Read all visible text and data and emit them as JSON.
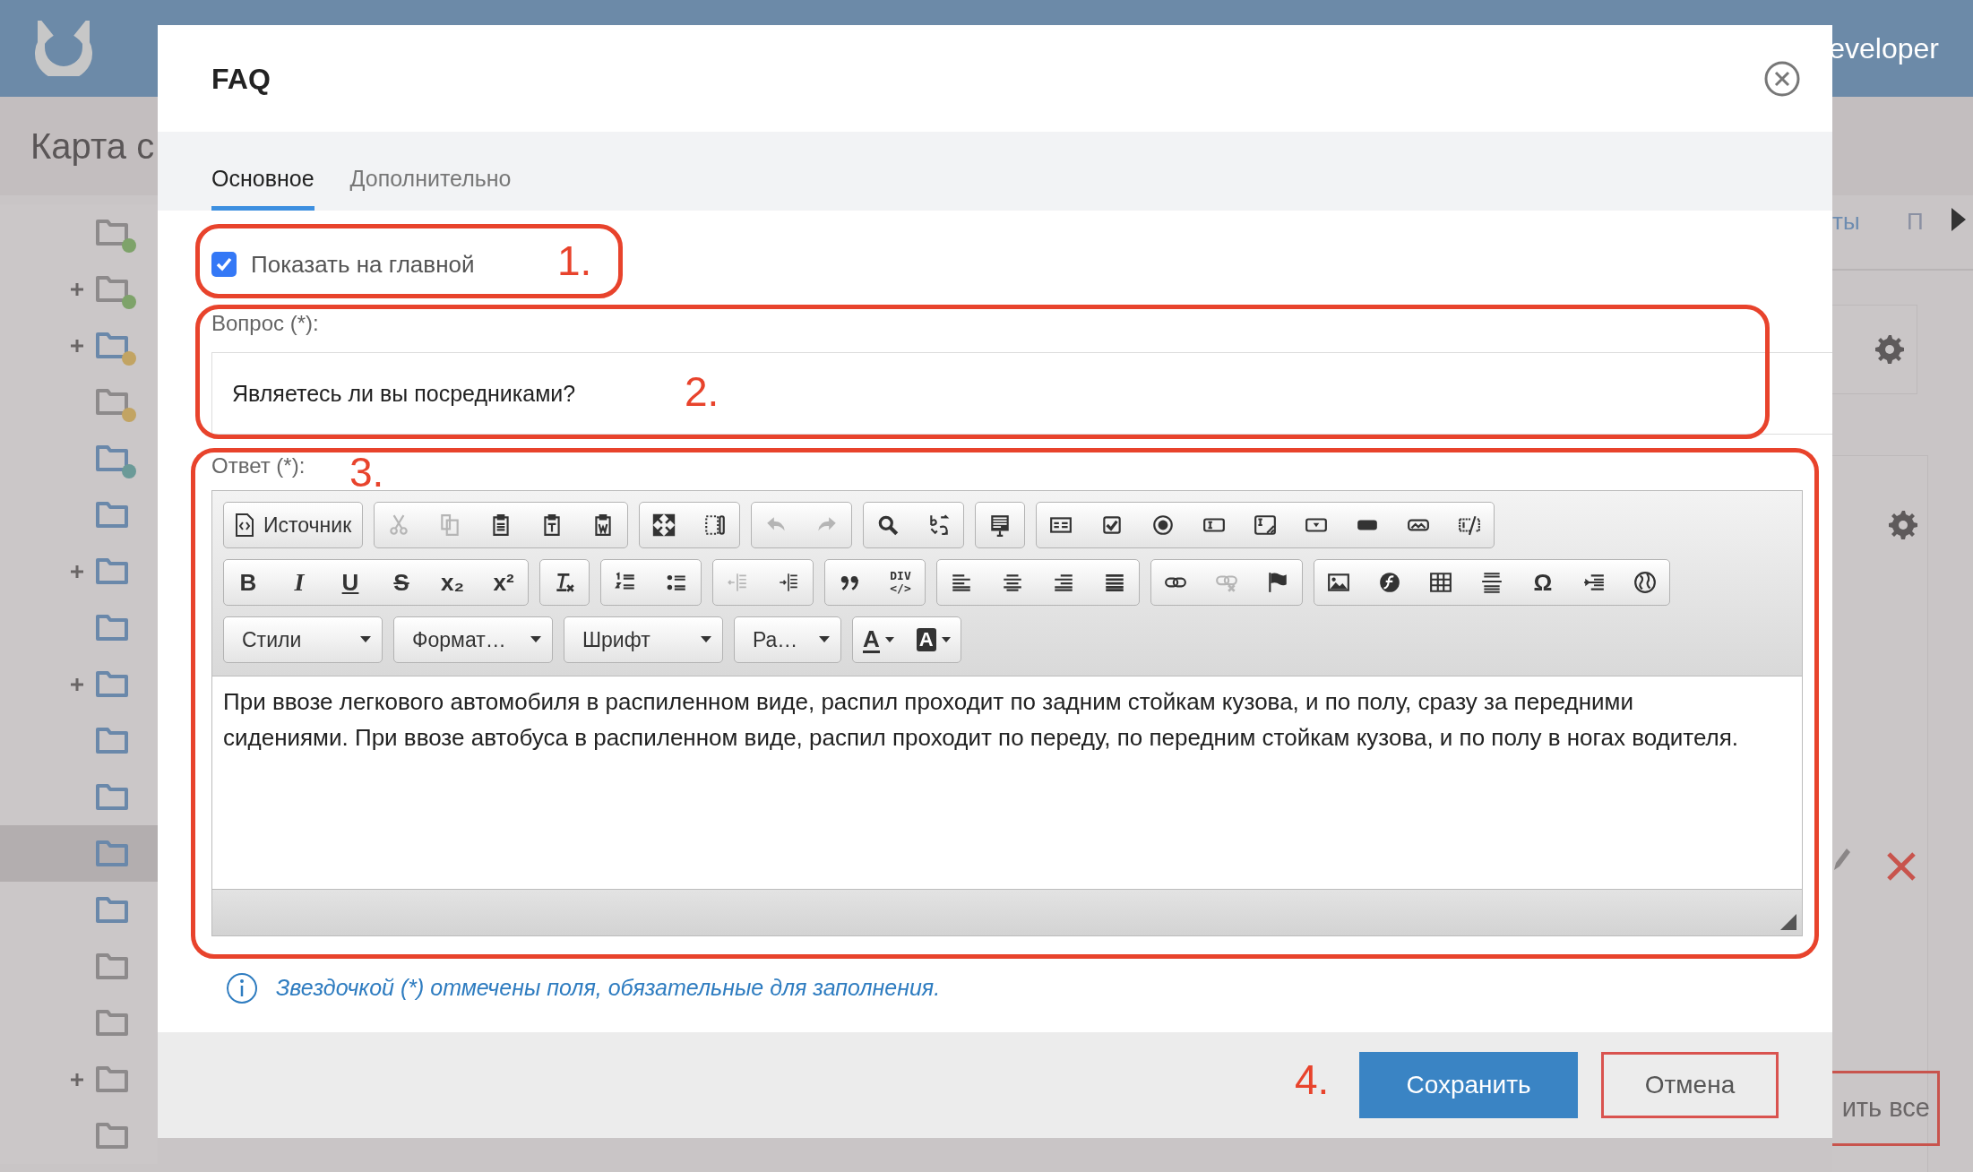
{
  "app_bar": {
    "user": "eveloper"
  },
  "page_title": "Карта с",
  "tree": [
    {
      "expandable": false,
      "active": false,
      "color": "#7ea36a",
      "selected": false
    },
    {
      "expandable": true,
      "active": false,
      "color": "#7ea36a",
      "selected": false
    },
    {
      "expandable": true,
      "active": true,
      "color": "#c2a463",
      "selected": false
    },
    {
      "expandable": false,
      "active": false,
      "color": "#c2a463",
      "selected": false
    },
    {
      "expandable": false,
      "active": true,
      "color": "#6b9a98",
      "selected": false
    },
    {
      "expandable": false,
      "active": true,
      "selected": false
    },
    {
      "expandable": true,
      "active": true,
      "selected": false
    },
    {
      "expandable": false,
      "active": true,
      "selected": false
    },
    {
      "expandable": true,
      "active": true,
      "selected": false
    },
    {
      "expandable": false,
      "active": true,
      "selected": false
    },
    {
      "expandable": false,
      "active": true,
      "selected": false
    },
    {
      "expandable": false,
      "active": true,
      "selected": true
    },
    {
      "expandable": false,
      "active": true,
      "selected": false
    },
    {
      "expandable": false,
      "active": false,
      "selected": false
    },
    {
      "expandable": false,
      "active": false,
      "selected": false
    },
    {
      "expandable": true,
      "active": false,
      "selected": false
    },
    {
      "expandable": false,
      "active": false,
      "selected": false
    }
  ],
  "right_tabs": [
    {
      "label": "ты",
      "disabled": false
    },
    {
      "label": "П",
      "disabled": true
    }
  ],
  "save_all_button": "ить все",
  "dialog": {
    "title": "FAQ",
    "tabs": [
      {
        "label": "Основное",
        "selected": true
      },
      {
        "label": "Дополнительно",
        "selected": false
      }
    ],
    "show_on_main": {
      "label": "Показать на главной",
      "checked": true
    },
    "question": {
      "label": "Вопрос (*):",
      "value": "Являетесь ли вы посредниками?"
    },
    "answer": {
      "label": "Ответ (*):",
      "toolbar": [
        [
          [
            {
              "kind": "button",
              "label": "Источник"
            }
          ],
          [
            {
              "kind": "icon",
              "disabled": true
            },
            {
              "kind": "icon",
              "disabled": true
            },
            {
              "kind": "icon",
              "disabled": false
            },
            {
              "kind": "icon",
              "disabled": false
            },
            {
              "kind": "icon",
              "disabled": false
            }
          ],
          [
            {
              "kind": "icon",
              "disabled": false
            },
            {
              "kind": "icon",
              "disabled": false
            }
          ],
          [
            {
              "kind": "icon",
              "disabled": true
            },
            {
              "kind": "icon",
              "disabled": true
            }
          ],
          [
            {
              "kind": "icon",
              "disabled": false
            },
            {
              "kind": "icon",
              "disabled": false
            }
          ],
          [
            {
              "kind": "icon",
              "disabled": false
            }
          ],
          [
            {
              "kind": "icon",
              "disabled": false
            },
            {
              "kind": "icon",
              "disabled": false
            },
            {
              "kind": "icon",
              "disabled": false
            },
            {
              "kind": "icon",
              "disabled": false
            },
            {
              "kind": "icon",
              "disabled": false
            },
            {
              "kind": "icon",
              "disabled": false
            },
            {
              "kind": "icon",
              "disabled": false
            },
            {
              "kind": "icon",
              "disabled": false
            },
            {
              "kind": "icon",
              "disabled": false
            }
          ]
        ],
        [
          [
            {
              "kind": "bold",
              "text": "B",
              "disabled": false
            },
            {
              "kind": "italic",
              "text": "I",
              "disabled": false
            },
            {
              "kind": "underline",
              "text": "U",
              "disabled": false
            },
            {
              "kind": "strike",
              "text": "S",
              "disabled": false
            },
            {
              "kind": "bold",
              "text": "x₂",
              "disabled": false
            },
            {
              "kind": "bold",
              "text": "x²",
              "disabled": false
            }
          ],
          [
            {
              "kind": "icon",
              "disabled": false
            }
          ],
          [
            {
              "kind": "icon",
              "disabled": false
            },
            {
              "kind": "icon",
              "disabled": false
            }
          ],
          [
            {
              "kind": "icon",
              "disabled": true
            },
            {
              "kind": "icon",
              "disabled": false
            }
          ],
          [
            {
              "kind": "icon",
              "disabled": false
            },
            {
              "kind": "small",
              "text": "DIV\n</>",
              "disabled": false
            }
          ],
          [
            {
              "kind": "icon",
              "disabled": false
            },
            {
              "kind": "icon",
              "disabled": false
            },
            {
              "kind": "icon",
              "disabled": false
            },
            {
              "kind": "icon",
              "disabled": false
            }
          ],
          [
            {
              "kind": "icon",
              "disabled": false
            },
            {
              "kind": "icon",
              "disabled": true
            },
            {
              "kind": "icon",
              "disabled": false
            }
          ],
          [
            {
              "kind": "icon",
              "disabled": false
            },
            {
              "kind": "icon",
              "disabled": false
            },
            {
              "kind": "icon",
              "disabled": false
            },
            {
              "kind": "icon",
              "disabled": false
            },
            {
              "kind": "bold",
              "text": "Ω",
              "disabled": false
            },
            {
              "kind": "icon",
              "disabled": false
            },
            {
              "kind": "icon",
              "disabled": false
            }
          ]
        ],
        [
          [
            {
              "kind": "combo",
              "label": "Стили"
            }
          ],
          [
            {
              "kind": "combo",
              "label": "Формат…"
            }
          ],
          [
            {
              "kind": "combo",
              "label": "Шрифт"
            }
          ],
          [
            {
              "kind": "combo",
              "label": "Ра…"
            }
          ],
          [
            {
              "kind": "textcolor",
              "text": "A"
            },
            {
              "kind": "bgcolor",
              "text": "A"
            }
          ]
        ]
      ],
      "content": "При ввозе легкового автомобиля в распиленном виде, распил проходит по задним стойкам кузова, и по полу, сразу за передними сидениями. При ввозе автобуса в распиленном виде, распил проходит по переду, по передним стойкам кузова, и по полу в ногах водителя."
    },
    "note": "Звездочкой (*) отмечены поля, обязательные для заполнения.",
    "buttons": [
      {
        "label": "Сохранить",
        "kind": "primary"
      },
      {
        "label": "Отмена",
        "kind": "secondary"
      }
    ]
  },
  "annotations": [
    {
      "number": "1."
    },
    {
      "number": "2."
    },
    {
      "number": "3."
    },
    {
      "number": "4."
    }
  ]
}
